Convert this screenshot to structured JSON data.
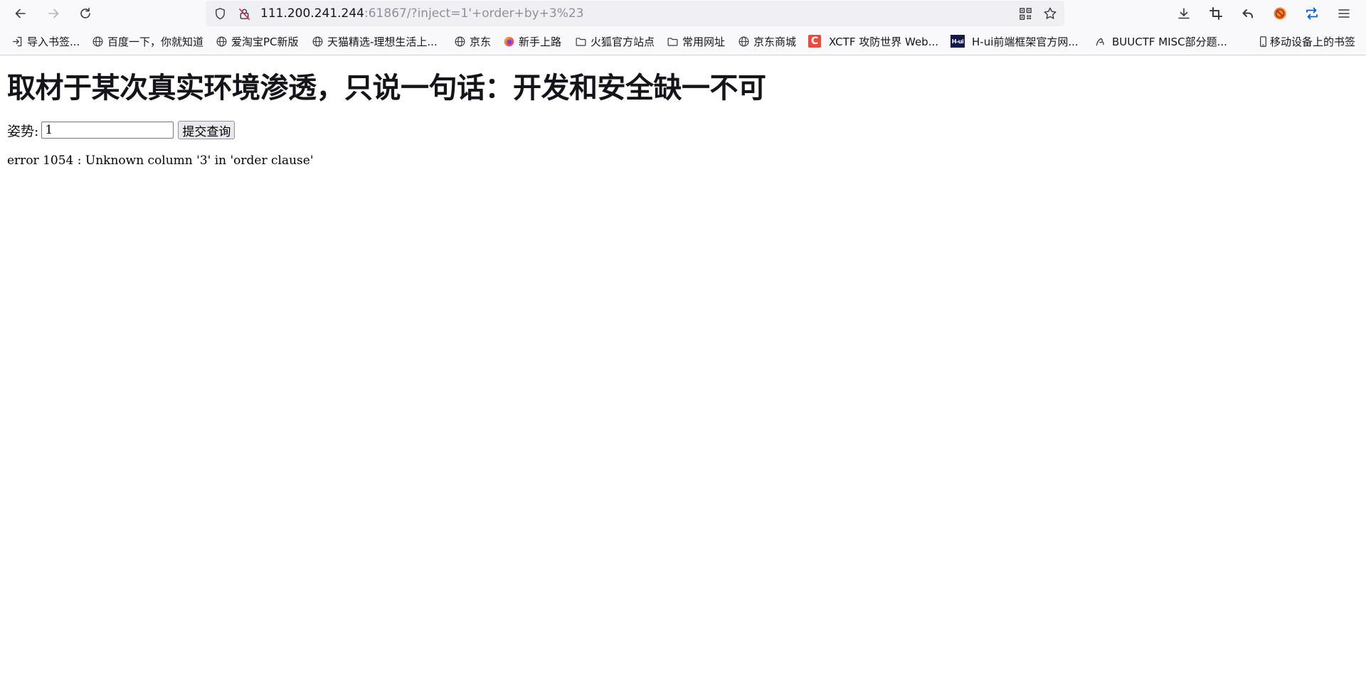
{
  "toolbar": {
    "back_icon": "arrow-left-icon",
    "forward_icon": "arrow-right-icon",
    "reload_icon": "reload-icon",
    "url_host": "111.200.241.244",
    "url_rest": ":61867/?inject=1'+order+by+3%23"
  },
  "bookmarks": [
    {
      "label": "导入书签...",
      "icon": "import-icon"
    },
    {
      "label": "百度一下，你就知道",
      "icon": "globe-icon"
    },
    {
      "label": "爱淘宝PC新版",
      "icon": "globe-icon"
    },
    {
      "label": "天猫精选-理想生活上...",
      "icon": "globe-icon"
    },
    {
      "label": "京东",
      "icon": "globe-icon"
    },
    {
      "label": "新手上路",
      "icon": "firefox-icon"
    },
    {
      "label": "火狐官方站点",
      "icon": "folder-icon"
    },
    {
      "label": "常用网址",
      "icon": "folder-icon"
    },
    {
      "label": "京东商城",
      "icon": "globe-icon"
    },
    {
      "label": "XCTF 攻防世界 Web...",
      "icon": "xctf-icon",
      "icon_text": "C"
    },
    {
      "label": "H-ui前端框架官方网...",
      "icon": "hui-icon",
      "icon_text": "H-ui"
    },
    {
      "label": "BUUCTF MISC部分题...",
      "icon": "buuctf-icon"
    }
  ],
  "mobile_bookmarks": {
    "label": "移动设备上的书签",
    "icon": "mobile-icon"
  },
  "page": {
    "heading": "取材于某次真实环境渗透，只说一句话：开发和安全缺一不可",
    "form_label": "姿势:",
    "input_value": "1",
    "submit_label": "提交查询",
    "error": "error 1054 : Unknown column '3' in 'order clause'"
  },
  "colors": {
    "toolbar_bg": "#f9f9fb",
    "urlbar_bg": "#f0f0f4",
    "url_dim": "#8f8f9d",
    "accent_blue": "#0060df",
    "xctf_red": "#e84c3d"
  }
}
